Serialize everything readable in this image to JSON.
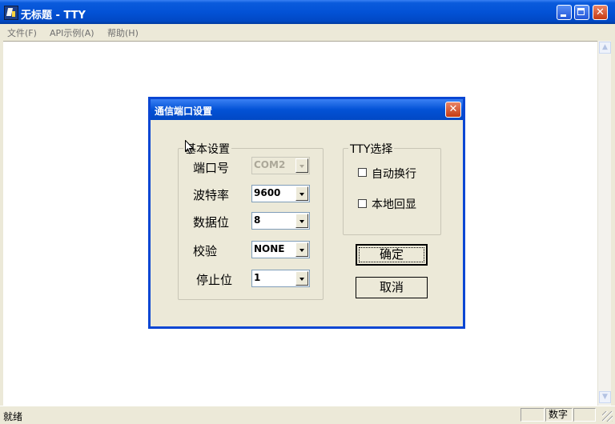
{
  "window": {
    "title": "无标题 - TTY",
    "menu": [
      "文件(F)",
      "API示例(A)",
      "帮助(H)"
    ],
    "controls": {
      "minimize": "minimize-icon",
      "maximize": "maximize-icon",
      "close": "close-icon"
    }
  },
  "status": {
    "text": "就绪",
    "pane_num": "数字"
  },
  "dialog": {
    "title": "通信端口设置",
    "basic_group": {
      "title": "基本设置",
      "fields": [
        {
          "label": "端口号",
          "value": "COM2",
          "enabled": false
        },
        {
          "label": "波特率",
          "value": "9600",
          "enabled": true
        },
        {
          "label": "数据位",
          "value": "8",
          "enabled": true
        },
        {
          "label": "校验",
          "value": "NONE",
          "enabled": true
        },
        {
          "label": "停止位",
          "value": "1",
          "enabled": true
        }
      ]
    },
    "tty_group": {
      "title": "TTY选择",
      "options": [
        {
          "label": "自动换行",
          "checked": false
        },
        {
          "label": "本地回显",
          "checked": false
        }
      ]
    },
    "ok_label": "确定",
    "cancel_label": "取消"
  },
  "colors": {
    "titlebar": "#0352d6",
    "dialog_border": "#0a46d3",
    "face": "#ece9d8",
    "close_button": "#c63b13"
  }
}
